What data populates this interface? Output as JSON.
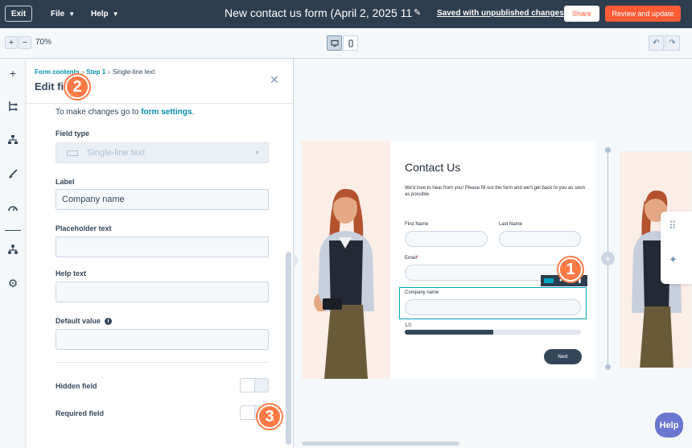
{
  "topbar": {
    "exit_label": "Exit",
    "menus": [
      {
        "label": "File"
      },
      {
        "label": "Help"
      }
    ],
    "doc_title": "New contact us form (April 2, 2025 11:",
    "save_status": "Saved with unpublished changes",
    "share_label": "Share",
    "review_label": "Review and update"
  },
  "toolbar": {
    "zoom_in": "+",
    "zoom_out": "−",
    "zoom_level": "70%",
    "undo_icon": "undo-icon",
    "redo_icon": "redo-icon"
  },
  "rail": {
    "icons": [
      "plus-icon",
      "branch-icon",
      "hierarchy-icon",
      "brush-icon",
      "gauge-icon",
      "sitemap-icon",
      "gear-icon"
    ]
  },
  "panel": {
    "breadcrumb": [
      "Form contents",
      "Step 1",
      "Single-line text"
    ],
    "title": "Edit field",
    "hint_prefix": "To make changes go to ",
    "hint_link": "form settings",
    "hint_suffix": ".",
    "field_type_label": "Field type",
    "field_type_value": "Single-line text",
    "label_label": "Label",
    "label_value": "Company name",
    "placeholder_label": "Placeholder text",
    "placeholder_value": "",
    "help_label": "Help text",
    "help_value": "",
    "default_label": "Default value",
    "default_value": "",
    "hidden_label": "Hidden field",
    "hidden_on": false,
    "required_label": "Required field",
    "required_on": false
  },
  "badges": [
    "1",
    "2",
    "3"
  ],
  "preview": {
    "title": "Contact Us",
    "subtitle": "We'd love to hear from you! Please fill out the form and we'll get back to you as soon as possible.",
    "first_name": "First Name",
    "last_name": "Last Name",
    "email": "Email",
    "required_mark": "*",
    "company": "Company name",
    "progress_label": "1/2",
    "progress": 0.5,
    "next_label": "Next"
  },
  "help_label": "Help",
  "colors": {
    "topbar": "#2d3e50",
    "accent": "#ff5c35",
    "link": "#0091ae",
    "badge": "#ff7a45",
    "selection": "#00a4bd",
    "help": "#6a78d1"
  }
}
